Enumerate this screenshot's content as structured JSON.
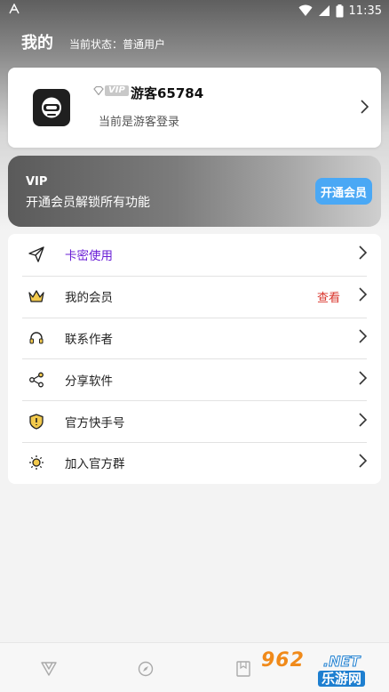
{
  "status_bar": {
    "left_icon": "android-a-icon",
    "time": "11:35"
  },
  "header": {
    "title": "我的",
    "current_status": "当前状态：普通用户"
  },
  "profile": {
    "vip_badge": "VIP",
    "username": "游客65784",
    "login_state": "当前是游客登录"
  },
  "vip_banner": {
    "title": "VIP",
    "description": "开通会员解锁所有功能",
    "button_label": "开通会员",
    "button_color": "#4aa8f5"
  },
  "menu": {
    "items": [
      {
        "label": "卡密使用",
        "icon": "paper-plane-icon",
        "highlight_color": "#6a1fd6"
      },
      {
        "label": "我的会员",
        "icon": "crown-icon",
        "extra": "查看",
        "extra_color": "#d9342b"
      },
      {
        "label": "联系作者",
        "icon": "headset-icon"
      },
      {
        "label": "分享软件",
        "icon": "share-icon"
      },
      {
        "label": "官方快手号",
        "icon": "shield-icon"
      },
      {
        "label": "加入官方群",
        "icon": "sun-icon"
      }
    ]
  },
  "bottom_nav": {
    "items": [
      "v-logo-icon",
      "compass-icon",
      "bookmark-icon"
    ]
  },
  "watermark": {
    "digits": "962",
    "suffix": ".NET",
    "site": "乐游网"
  }
}
